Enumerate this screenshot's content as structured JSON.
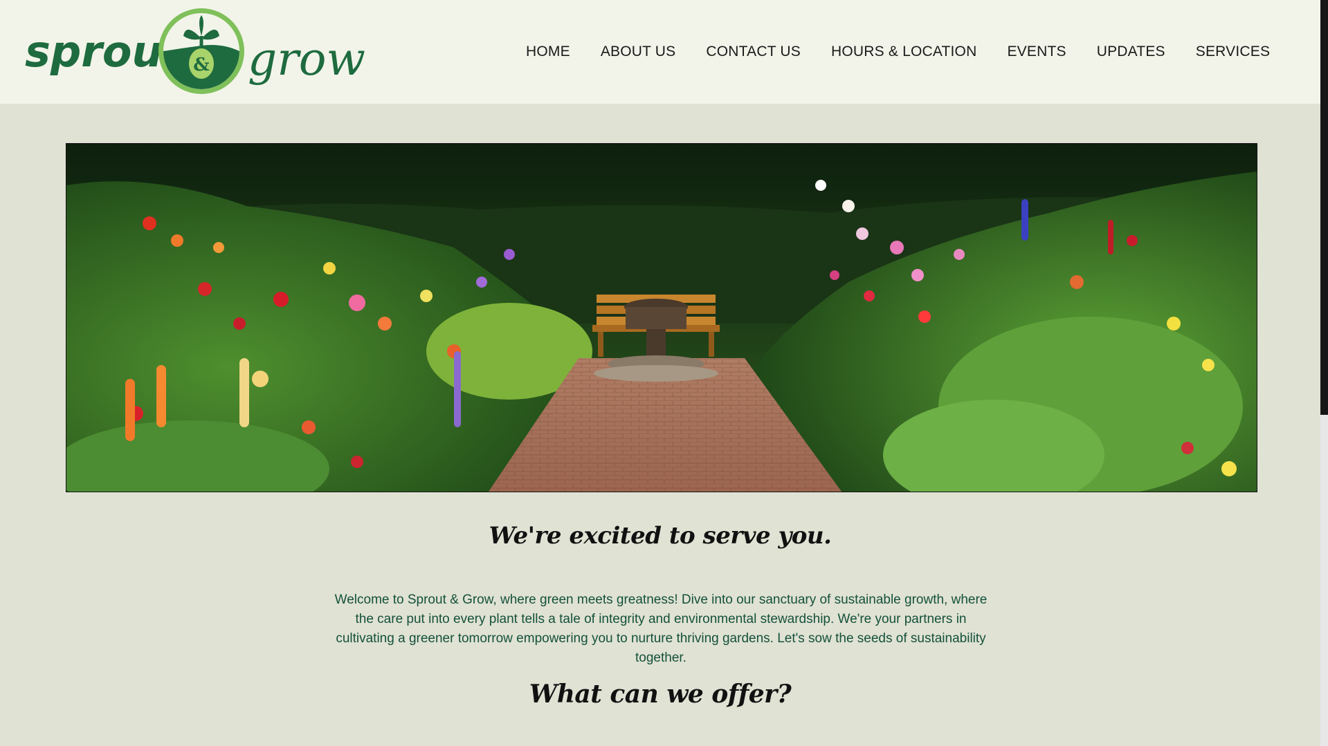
{
  "brand": {
    "word_left": "sprout",
    "ampersand": "&",
    "word_right": "grow",
    "colors": {
      "dark_green": "#1e6b3f",
      "light_green": "#7fc05a",
      "accent": "#a9d36b"
    }
  },
  "nav": {
    "items": [
      {
        "label": "HOME"
      },
      {
        "label": "ABOUT US"
      },
      {
        "label": "CONTACT US"
      },
      {
        "label": "HOURS & LOCATION"
      },
      {
        "label": "EVENTS"
      },
      {
        "label": "UPDATES"
      },
      {
        "label": "SERVICES"
      }
    ]
  },
  "hero": {
    "image": "garden-path-with-bench-and-fountain"
  },
  "main": {
    "tagline": "We're excited to serve you.",
    "intro": "Welcome to Sprout & Grow, where green meets greatness! Dive into our sanctuary of sustainable growth, where the care put into every plant tells a tale of integrity and environmental stewardship. We're your partners in cultivating a greener tomorrow empowering you to nurture thriving gardens. Let's sow the seeds of sustainability together.",
    "offer_heading": "What can we offer?"
  },
  "colors": {
    "header_bg": "#f2f4e9",
    "page_bg": "#e0e2d4",
    "text_green": "#14513a"
  }
}
